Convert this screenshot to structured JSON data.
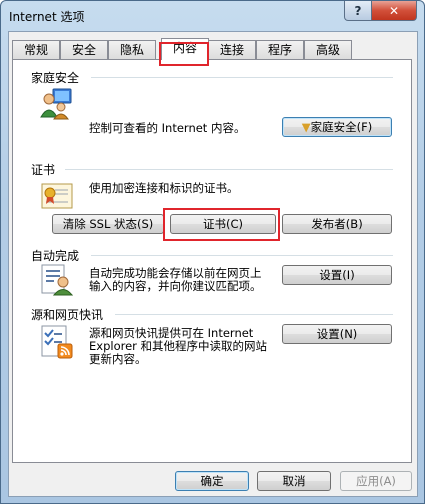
{
  "window": {
    "title": "Internet 选项",
    "help_label": "?",
    "close_label": "✕"
  },
  "tabs": [
    {
      "label": "常规"
    },
    {
      "label": "安全"
    },
    {
      "label": "隐私"
    },
    {
      "label": "内容",
      "active": true
    },
    {
      "label": "连接"
    },
    {
      "label": "程序"
    },
    {
      "label": "高级"
    }
  ],
  "family_safety": {
    "title": "家庭安全",
    "description": "控制可查看的 Internet 内容。",
    "button_label": "家庭安全(F)",
    "icon": "family-safety-icon"
  },
  "certificates": {
    "title": "证书",
    "description": "使用加密连接和标识的证书。",
    "clear_ssl_label": "清除 SSL 状态(S)",
    "certificates_label": "证书(C)",
    "publishers_label": "发布者(B)",
    "icon": "certificate-icon"
  },
  "autocomplete": {
    "title": "自动完成",
    "description_line1": "自动完成功能会存储以前在网页上",
    "description_line2": "输入的内容，并向你建议匹配项。",
    "settings_label": "设置(I)",
    "icon": "autocomplete-icon"
  },
  "feeds": {
    "title": "源和网页快讯",
    "description_line1": "源和网页快讯提供可在 Internet",
    "description_line2": "Explorer 和其他程序中读取的网站",
    "description_line3": "更新内容。",
    "settings_label": "设置(N)",
    "icon": "feeds-icon"
  },
  "footer": {
    "ok_label": "确定",
    "cancel_label": "取消",
    "apply_label": "应用(A)"
  },
  "colors": {
    "accent_red": "#e0252c",
    "titlebar": "#b3cde6"
  }
}
